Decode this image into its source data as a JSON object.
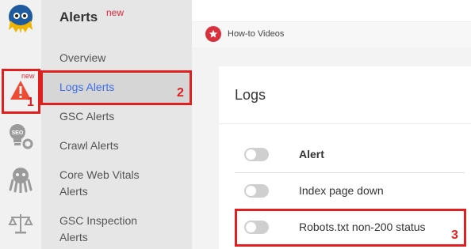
{
  "rail": {
    "items": [
      {
        "name": "logo",
        "icon": "octopus-logo-icon"
      },
      {
        "name": "alerts",
        "icon": "warning-triangle-icon",
        "badge": "new"
      },
      {
        "name": "seo",
        "icon": "seo-bulb-gear-icon"
      },
      {
        "name": "crawl",
        "icon": "octopus-icon"
      },
      {
        "name": "inspection",
        "icon": "scales-icon"
      }
    ],
    "alerts_badge": "new"
  },
  "menu": {
    "title": "Alerts",
    "title_badge": "new",
    "items": [
      {
        "label": "Overview"
      },
      {
        "label": "Logs Alerts",
        "active": true
      },
      {
        "label": "GSC Alerts"
      },
      {
        "label": "Crawl Alerts"
      },
      {
        "label": "Core Web Vitals Alerts"
      },
      {
        "label": "GSC Inspection Alerts"
      }
    ],
    "item_lines": {
      "cwv_line1": "Core Web Vitals",
      "cwv_line2": "Alerts",
      "gsci_line1": "GSC Inspection",
      "gsci_line2": "Alerts"
    }
  },
  "howto": {
    "label": "How-to Videos",
    "icon": "star-icon"
  },
  "logs": {
    "title": "Logs",
    "header": "Alert",
    "rows": [
      {
        "label": "Index page down",
        "enabled": false
      },
      {
        "label": "Robots.txt non-200 status",
        "enabled": false
      }
    ]
  },
  "annotations": [
    "1",
    "2",
    "3"
  ],
  "colors": {
    "accent": "#3c6ee6",
    "badge": "#e0263a",
    "annotation": "#e02020",
    "star": "#d9303e"
  }
}
